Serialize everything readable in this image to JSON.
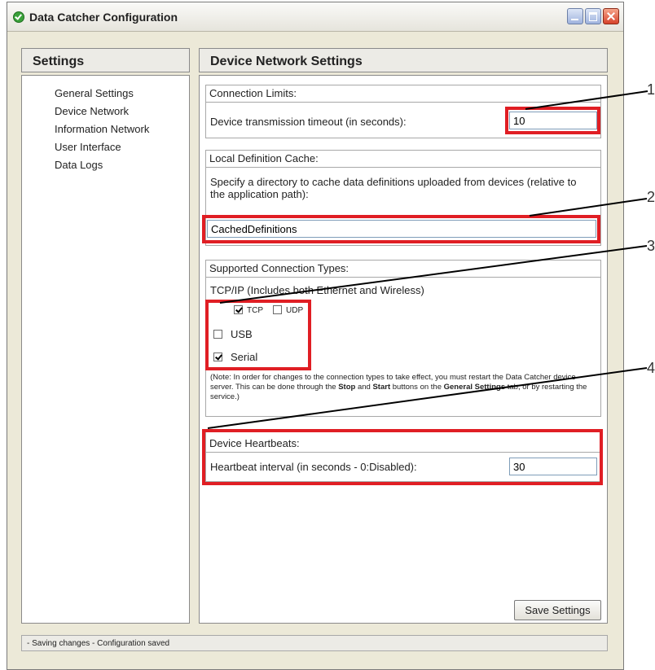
{
  "window": {
    "title": "Data Catcher Configuration"
  },
  "sidebar": {
    "header": "Settings",
    "items": [
      {
        "label": "General Settings"
      },
      {
        "label": "Device Network"
      },
      {
        "label": "Information Network"
      },
      {
        "label": "User Interface"
      },
      {
        "label": "Data Logs"
      }
    ]
  },
  "main": {
    "header": "Device Network Settings",
    "connection_limits": {
      "title": "Connection Limits:",
      "timeout_label": "Device transmission timeout (in seconds):",
      "timeout_value": "10"
    },
    "cache": {
      "title": "Local Definition Cache:",
      "description": "Specify a directory to cache data definitions uploaded from devices (relative to the application path):",
      "directory_value": "CachedDefinitions"
    },
    "connection_types": {
      "title": "Supported Connection Types:",
      "tcpip_label": "TCP/IP (Includes both Ethernet and Wireless)",
      "tcp_label": "TCP",
      "tcp_checked": true,
      "udp_label": "UDP",
      "udp_checked": false,
      "usb_label": "USB",
      "usb_checked": false,
      "serial_label": "Serial",
      "serial_checked": true,
      "note_part1": "(Note: In order for changes to the connection types to take effect, you must restart the Data Catcher device server. This can be done through the ",
      "note_stop": "Stop",
      "note_and": " and ",
      "note_start": "Start",
      "note_part2": " buttons on the ",
      "note_general": "General Settings",
      "note_part3": " tab, or by restarting the service.)"
    },
    "heartbeats": {
      "title": "Device Heartbeats:",
      "interval_label": "Heartbeat interval (in seconds - 0:Disabled):",
      "interval_value": "30"
    },
    "save_label": "Save Settings"
  },
  "status_text": "- Saving changes - Configuration saved",
  "callouts": [
    "1",
    "2",
    "3",
    "4"
  ],
  "colors": {
    "highlight": "#e01e24",
    "window_bg": "#ece9d8"
  }
}
